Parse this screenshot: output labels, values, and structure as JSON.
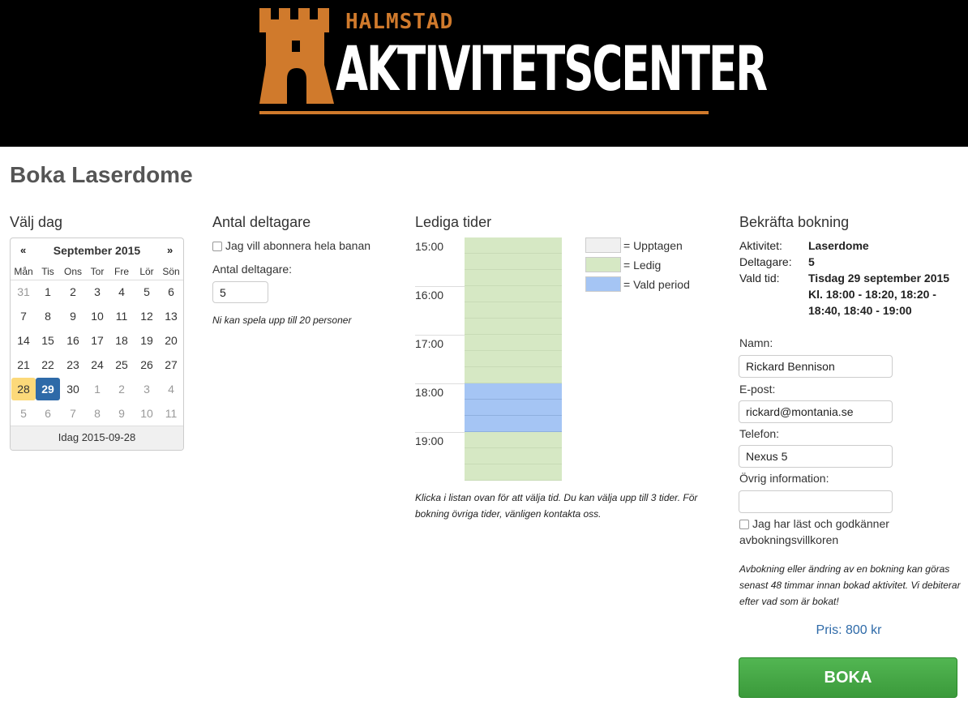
{
  "header": {
    "city": "HALMSTAD",
    "brand": "AKTIVITETSCENTER",
    "logo_color": "#d07a2c"
  },
  "page": {
    "title": "Boka Laserdome"
  },
  "calendar": {
    "title": "Välj dag",
    "prev_label": "«",
    "next_label": "»",
    "month_label": "September 2015",
    "weekdays": [
      "Mån",
      "Tis",
      "Ons",
      "Tor",
      "Fre",
      "Lör",
      "Sön"
    ],
    "weeks": [
      [
        "31",
        "1",
        "2",
        "3",
        "4",
        "5",
        "6"
      ],
      [
        "7",
        "8",
        "9",
        "10",
        "11",
        "12",
        "13"
      ],
      [
        "14",
        "15",
        "16",
        "17",
        "18",
        "19",
        "20"
      ],
      [
        "21",
        "22",
        "23",
        "24",
        "25",
        "26",
        "27"
      ],
      [
        "28",
        "29",
        "30",
        "1",
        "2",
        "3",
        "4"
      ],
      [
        "5",
        "6",
        "7",
        "8",
        "9",
        "10",
        "11"
      ]
    ],
    "today_label": "Idag 2015-09-28",
    "today_day": "28",
    "selected_day": "29",
    "today_color": "#fcd97a",
    "selected_color": "#2e6aa8"
  },
  "participants": {
    "title": "Antal deltagare",
    "subscribe_label": "Jag vill abonnera hela banan",
    "count_label": "Antal deltagare:",
    "count_value": "5",
    "note": "Ni kan spela upp till 20 personer"
  },
  "times": {
    "title": "Lediga tider",
    "hours": [
      "15:00",
      "16:00",
      "17:00",
      "18:00",
      "19:00"
    ],
    "slots": [
      "ledig",
      "ledig",
      "ledig",
      "ledig",
      "ledig",
      "ledig",
      "ledig",
      "ledig",
      "ledig",
      "vald",
      "vald",
      "vald",
      "ledig",
      "ledig",
      "ledig"
    ],
    "legend": [
      {
        "label": "= Upptagen",
        "color": "#f0f0f0"
      },
      {
        "label": "= Ledig",
        "color": "#d6e8c4"
      },
      {
        "label": "= Vald period",
        "color": "#a5c5f4"
      }
    ],
    "note": "Klicka i listan ovan för att välja tid. Du kan välja upp till 3 tider. För bokning övriga tider, vänligen kontakta oss."
  },
  "confirm": {
    "title": "Bekräfta bokning",
    "activity_key": "Aktivitet:",
    "activity_value": "Laserdome",
    "participants_key": "Deltagare:",
    "participants_value": "5",
    "time_key": "Vald tid:",
    "time_line1": "Tisdag 29 september 2015",
    "time_line2": "Kl. 18:00 - 18:20, 18:20 -",
    "time_line3": "18:40, 18:40 - 19:00",
    "name_label": "Namn:",
    "name_value": "Rickard Bennison",
    "email_label": "E-post:",
    "email_value": "rickard@montania.se",
    "phone_label": "Telefon:",
    "phone_value": "Nexus 5",
    "other_label": "Övrig information:",
    "other_value": "",
    "terms_line1": "Jag har läst och godkänner",
    "terms_line2": "avbokningsvillkoren",
    "cancel_note": "Avbokning eller ändring av en bokning kan göras senast 48 timmar innan bokad aktivitet. Vi debiterar efter vad som är bokat!",
    "price": "Pris: 800 kr",
    "submit_label": "BOKA"
  }
}
